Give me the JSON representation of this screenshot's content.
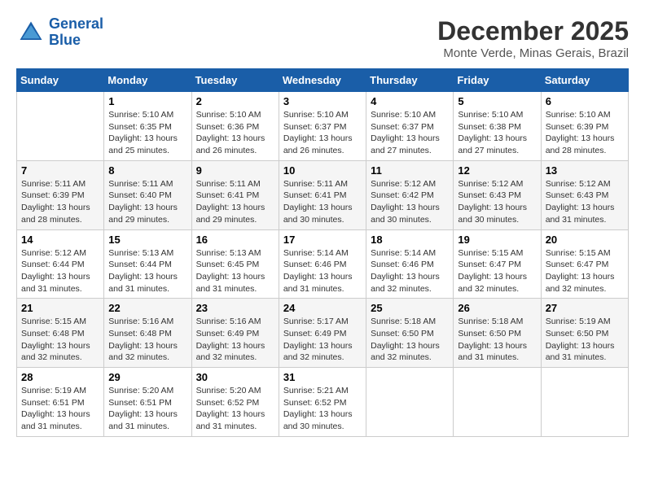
{
  "logo": {
    "line1": "General",
    "line2": "Blue"
  },
  "title": "December 2025",
  "subtitle": "Monte Verde, Minas Gerais, Brazil",
  "days_of_week": [
    "Sunday",
    "Monday",
    "Tuesday",
    "Wednesday",
    "Thursday",
    "Friday",
    "Saturday"
  ],
  "weeks": [
    [
      {
        "day": "",
        "info": ""
      },
      {
        "day": "1",
        "info": "Sunrise: 5:10 AM\nSunset: 6:35 PM\nDaylight: 13 hours\nand 25 minutes."
      },
      {
        "day": "2",
        "info": "Sunrise: 5:10 AM\nSunset: 6:36 PM\nDaylight: 13 hours\nand 26 minutes."
      },
      {
        "day": "3",
        "info": "Sunrise: 5:10 AM\nSunset: 6:37 PM\nDaylight: 13 hours\nand 26 minutes."
      },
      {
        "day": "4",
        "info": "Sunrise: 5:10 AM\nSunset: 6:37 PM\nDaylight: 13 hours\nand 27 minutes."
      },
      {
        "day": "5",
        "info": "Sunrise: 5:10 AM\nSunset: 6:38 PM\nDaylight: 13 hours\nand 27 minutes."
      },
      {
        "day": "6",
        "info": "Sunrise: 5:10 AM\nSunset: 6:39 PM\nDaylight: 13 hours\nand 28 minutes."
      }
    ],
    [
      {
        "day": "7",
        "info": "Sunrise: 5:11 AM\nSunset: 6:39 PM\nDaylight: 13 hours\nand 28 minutes."
      },
      {
        "day": "8",
        "info": "Sunrise: 5:11 AM\nSunset: 6:40 PM\nDaylight: 13 hours\nand 29 minutes."
      },
      {
        "day": "9",
        "info": "Sunrise: 5:11 AM\nSunset: 6:41 PM\nDaylight: 13 hours\nand 29 minutes."
      },
      {
        "day": "10",
        "info": "Sunrise: 5:11 AM\nSunset: 6:41 PM\nDaylight: 13 hours\nand 30 minutes."
      },
      {
        "day": "11",
        "info": "Sunrise: 5:12 AM\nSunset: 6:42 PM\nDaylight: 13 hours\nand 30 minutes."
      },
      {
        "day": "12",
        "info": "Sunrise: 5:12 AM\nSunset: 6:43 PM\nDaylight: 13 hours\nand 30 minutes."
      },
      {
        "day": "13",
        "info": "Sunrise: 5:12 AM\nSunset: 6:43 PM\nDaylight: 13 hours\nand 31 minutes."
      }
    ],
    [
      {
        "day": "14",
        "info": "Sunrise: 5:12 AM\nSunset: 6:44 PM\nDaylight: 13 hours\nand 31 minutes."
      },
      {
        "day": "15",
        "info": "Sunrise: 5:13 AM\nSunset: 6:44 PM\nDaylight: 13 hours\nand 31 minutes."
      },
      {
        "day": "16",
        "info": "Sunrise: 5:13 AM\nSunset: 6:45 PM\nDaylight: 13 hours\nand 31 minutes."
      },
      {
        "day": "17",
        "info": "Sunrise: 5:14 AM\nSunset: 6:46 PM\nDaylight: 13 hours\nand 31 minutes."
      },
      {
        "day": "18",
        "info": "Sunrise: 5:14 AM\nSunset: 6:46 PM\nDaylight: 13 hours\nand 32 minutes."
      },
      {
        "day": "19",
        "info": "Sunrise: 5:15 AM\nSunset: 6:47 PM\nDaylight: 13 hours\nand 32 minutes."
      },
      {
        "day": "20",
        "info": "Sunrise: 5:15 AM\nSunset: 6:47 PM\nDaylight: 13 hours\nand 32 minutes."
      }
    ],
    [
      {
        "day": "21",
        "info": "Sunrise: 5:15 AM\nSunset: 6:48 PM\nDaylight: 13 hours\nand 32 minutes."
      },
      {
        "day": "22",
        "info": "Sunrise: 5:16 AM\nSunset: 6:48 PM\nDaylight: 13 hours\nand 32 minutes."
      },
      {
        "day": "23",
        "info": "Sunrise: 5:16 AM\nSunset: 6:49 PM\nDaylight: 13 hours\nand 32 minutes."
      },
      {
        "day": "24",
        "info": "Sunrise: 5:17 AM\nSunset: 6:49 PM\nDaylight: 13 hours\nand 32 minutes."
      },
      {
        "day": "25",
        "info": "Sunrise: 5:18 AM\nSunset: 6:50 PM\nDaylight: 13 hours\nand 32 minutes."
      },
      {
        "day": "26",
        "info": "Sunrise: 5:18 AM\nSunset: 6:50 PM\nDaylight: 13 hours\nand 31 minutes."
      },
      {
        "day": "27",
        "info": "Sunrise: 5:19 AM\nSunset: 6:50 PM\nDaylight: 13 hours\nand 31 minutes."
      }
    ],
    [
      {
        "day": "28",
        "info": "Sunrise: 5:19 AM\nSunset: 6:51 PM\nDaylight: 13 hours\nand 31 minutes."
      },
      {
        "day": "29",
        "info": "Sunrise: 5:20 AM\nSunset: 6:51 PM\nDaylight: 13 hours\nand 31 minutes."
      },
      {
        "day": "30",
        "info": "Sunrise: 5:20 AM\nSunset: 6:52 PM\nDaylight: 13 hours\nand 31 minutes."
      },
      {
        "day": "31",
        "info": "Sunrise: 5:21 AM\nSunset: 6:52 PM\nDaylight: 13 hours\nand 30 minutes."
      },
      {
        "day": "",
        "info": ""
      },
      {
        "day": "",
        "info": ""
      },
      {
        "day": "",
        "info": ""
      }
    ]
  ]
}
